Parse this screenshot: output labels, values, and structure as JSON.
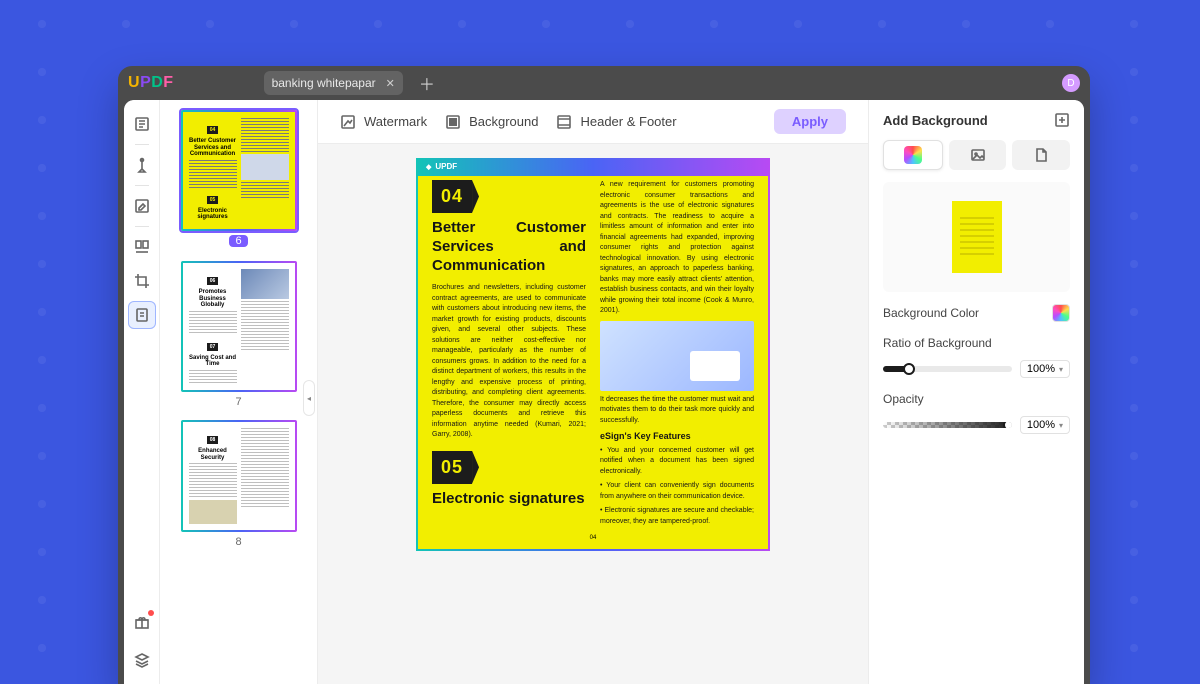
{
  "app_logo": "UPDF",
  "tab": {
    "title": "banking whitepapar"
  },
  "avatar_initial": "D",
  "toolbar_top": {
    "watermark": "Watermark",
    "background": "Background",
    "header_footer": "Header & Footer",
    "apply": "Apply"
  },
  "thumbnails": [
    {
      "num": "6",
      "active": true,
      "sections": [
        "04",
        "Better Customer Services and Communication",
        "05",
        "Electronic signatures"
      ]
    },
    {
      "num": "7",
      "active": false,
      "sections": [
        "06",
        "Promotes Business Globally",
        "07",
        "Saving Cost and Time"
      ]
    },
    {
      "num": "8",
      "active": false,
      "sections": [
        "08",
        "Enhanced Security"
      ]
    }
  ],
  "page": {
    "brand": "UPDF",
    "section_a_num": "04",
    "section_a_title": "Better Customer Services and Communication",
    "section_b_num": "05",
    "section_b_title": "Electronic signatures",
    "left_para_1": "Brochures and newsletters, including customer contract agreements, are used to communicate with customers about introducing new items, the market growth for existing products, discounts given, and several other subjects. These solutions are neither cost-effective nor manageable, particularly as the number of consumers grows. In addition to the need for a distinct department of workers, this results in the lengthy and expensive process of printing, distributing, and completing client agreements. Therefore, the consumer may directly access paperless documents and retrieve this information anytime needed (Kumari, 2021; Garry, 2008).",
    "right_para_1": "A new requirement for customers promoting electronic consumer transactions and agreements is the use of electronic signatures and contracts. The readiness to acquire a limitless amount of information and enter into financial agreements had expanded, improving consumer rights and protection against technological innovation. By using electronic signatures, an approach to paperless banking, banks may more easily attract clients' attention, establish business contacts, and win their loyalty while growing their total income (Cook & Munro, 2001).",
    "right_para_2": "It decreases the time the customer must wait and motivates them to do their task more quickly and successfully.",
    "features_heading": "eSign's Key Features",
    "feature_1": "• You and your concerned customer will get notified when a document has been signed electronically.",
    "feature_2": "• Your client can conveniently sign documents from anywhere on their communication device.",
    "feature_3": "• Electronic signatures are secure and checkable; moreover, they are tampered-proof.",
    "page_number": "04"
  },
  "panel": {
    "title": "Add Background",
    "bg_color_label": "Background Color",
    "ratio_label": "Ratio of Background",
    "ratio_value": "100%",
    "opacity_label": "Opacity",
    "opacity_value": "100%"
  }
}
